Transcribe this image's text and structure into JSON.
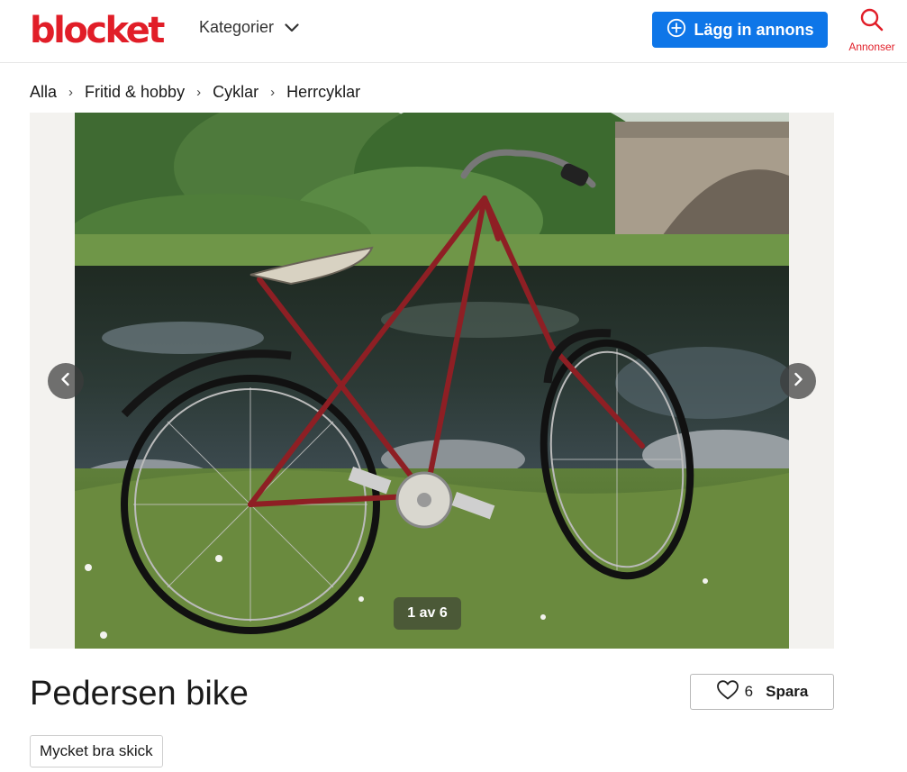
{
  "header": {
    "logo_text": "blocket",
    "categories_label": "Kategorier",
    "post_button_label": "Lägg in annons",
    "search_label": "Annonser",
    "brand_color": "#e11e28",
    "accent_color": "#0e76e8"
  },
  "breadcrumb": {
    "items": [
      {
        "label": "Alla"
      },
      {
        "label": "Fritid & hobby"
      },
      {
        "label": "Cyklar"
      },
      {
        "label": "Herrcyklar"
      }
    ],
    "separator": "›"
  },
  "gallery": {
    "counter": "1 av 6",
    "prev_icon": "chevron-left-icon",
    "next_icon": "chevron-right-icon"
  },
  "listing": {
    "title": "Pedersen bike",
    "save_count": "6",
    "save_label": "Spara",
    "condition": "Mycket bra skick"
  }
}
